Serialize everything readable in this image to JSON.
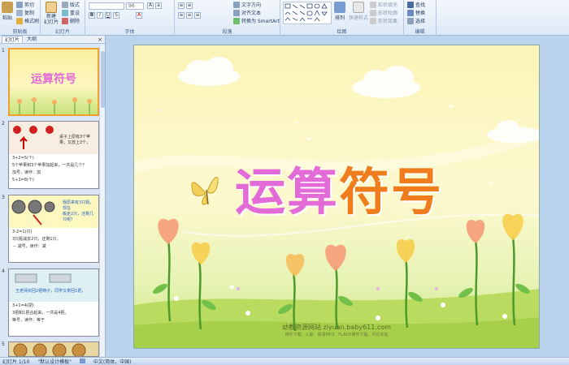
{
  "ribbon": {
    "clipboard": {
      "paste": "粘贴",
      "cut": "剪切",
      "copy": "复制",
      "format_painter": "格式刷",
      "label": "剪贴板"
    },
    "slides": {
      "new_slide": "新建\n幻灯片",
      "layout": "版式",
      "reset": "重设",
      "delete": "删除",
      "label": "幻灯片"
    },
    "font": {
      "size": "96",
      "label": "字体"
    },
    "paragraph": {
      "text_direction": "文字方向",
      "align_text": "对齐文本",
      "smartart": "转换为 SmartArt",
      "label": "段落"
    },
    "drawing": {
      "arrange": "排列",
      "quick_styles": "快速样式",
      "shape_fill": "形状填充",
      "shape_outline": "形状轮廓",
      "shape_effects": "形状效果",
      "label": "绘图"
    },
    "editing": {
      "find": "查找",
      "replace": "替换",
      "select": "选择",
      "label": "编辑"
    }
  },
  "panel": {
    "tabs": [
      "幻灯片",
      "大纲"
    ],
    "thumbnails": [
      {
        "num": "1",
        "title": "运算符号"
      },
      {
        "num": "2",
        "lines": [
          "桌子上原有3个苹果，又放上2个，",
          "3+2=5(个)",
          "5个苹果和3个苹果加起来，一共是几个？",
          "加号，读作：加",
          "5+3=8(个)"
        ]
      },
      {
        "num": "3",
        "lines": [
          "我原来有3只瓶，现在",
          "搬走2只，还剩几只呢？",
          "3-2=1(只)",
          "3只瓶减去2只，还剩1只。",
          "－ 减号，读作：减"
        ]
      },
      {
        "num": "4",
        "lines": [
          "王老师买回2把椅子，同学又拿回1把，",
          "3+1=4(把)",
          "3把和1把合起来，一共是4把。",
          "等号，读作：等于"
        ]
      },
      {
        "num": "5"
      }
    ]
  },
  "slide": {
    "title_part1": "运算",
    "title_part2": "符号",
    "footer": "幼教资源网站  ziyuan.baby611.com",
    "footer_sub": "课件下载、儿歌、故事MP3、FLASH课件下载，尽在本站"
  },
  "status": {
    "slide_count": "幻灯片 1/10",
    "theme": "\"默认设计模板\"",
    "language": "中文(简体，中国)"
  },
  "colors": {
    "title_pink": "#e36bd7",
    "title_orange": "#ef7d1d",
    "selection": "#f0a030"
  }
}
